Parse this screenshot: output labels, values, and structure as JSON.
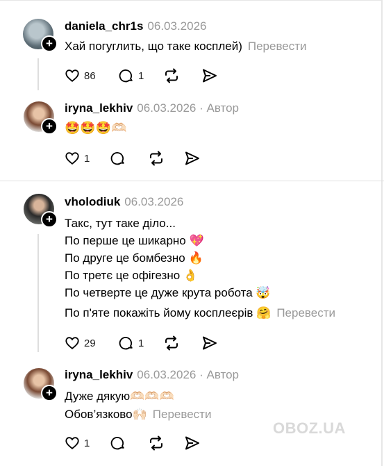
{
  "comments": [
    {
      "username": "daniela_chr1s",
      "date": "06.03.2026",
      "text": "Хай погуглить, що таке косплей)",
      "translate_label": "Перевести",
      "likes": "86",
      "replies": "1",
      "reply": {
        "username": "iryna_lekhiv",
        "date": "06.03.2026",
        "author_label": "· Автор",
        "text": "🤩🤩🤩🫶🏻",
        "likes": "1"
      }
    },
    {
      "username": "vholodiuk",
      "date": "06.03.2026",
      "lines": [
        "Такс, тут таке діло...",
        "По перше це шикарно 💖",
        "По друге це бомбезно 🔥",
        "По третє це офігезно 👌",
        "По четверте це дуже крута робота 🤯",
        "По п'яте покажіть йому косплеєрів 🤗"
      ],
      "translate_label": "Перевести",
      "likes": "29",
      "replies": "1",
      "reply": {
        "username": "iryna_lekhiv",
        "date": "06.03.2026",
        "author_label": "· Автор",
        "lines": [
          "Дуже дякую🫶🏻🫶🏻🫶🏻",
          "Обов’язково🙌🏻"
        ],
        "translate_label": "Перевести",
        "likes": "1"
      }
    }
  ],
  "watermark": "OBOZ.UA"
}
